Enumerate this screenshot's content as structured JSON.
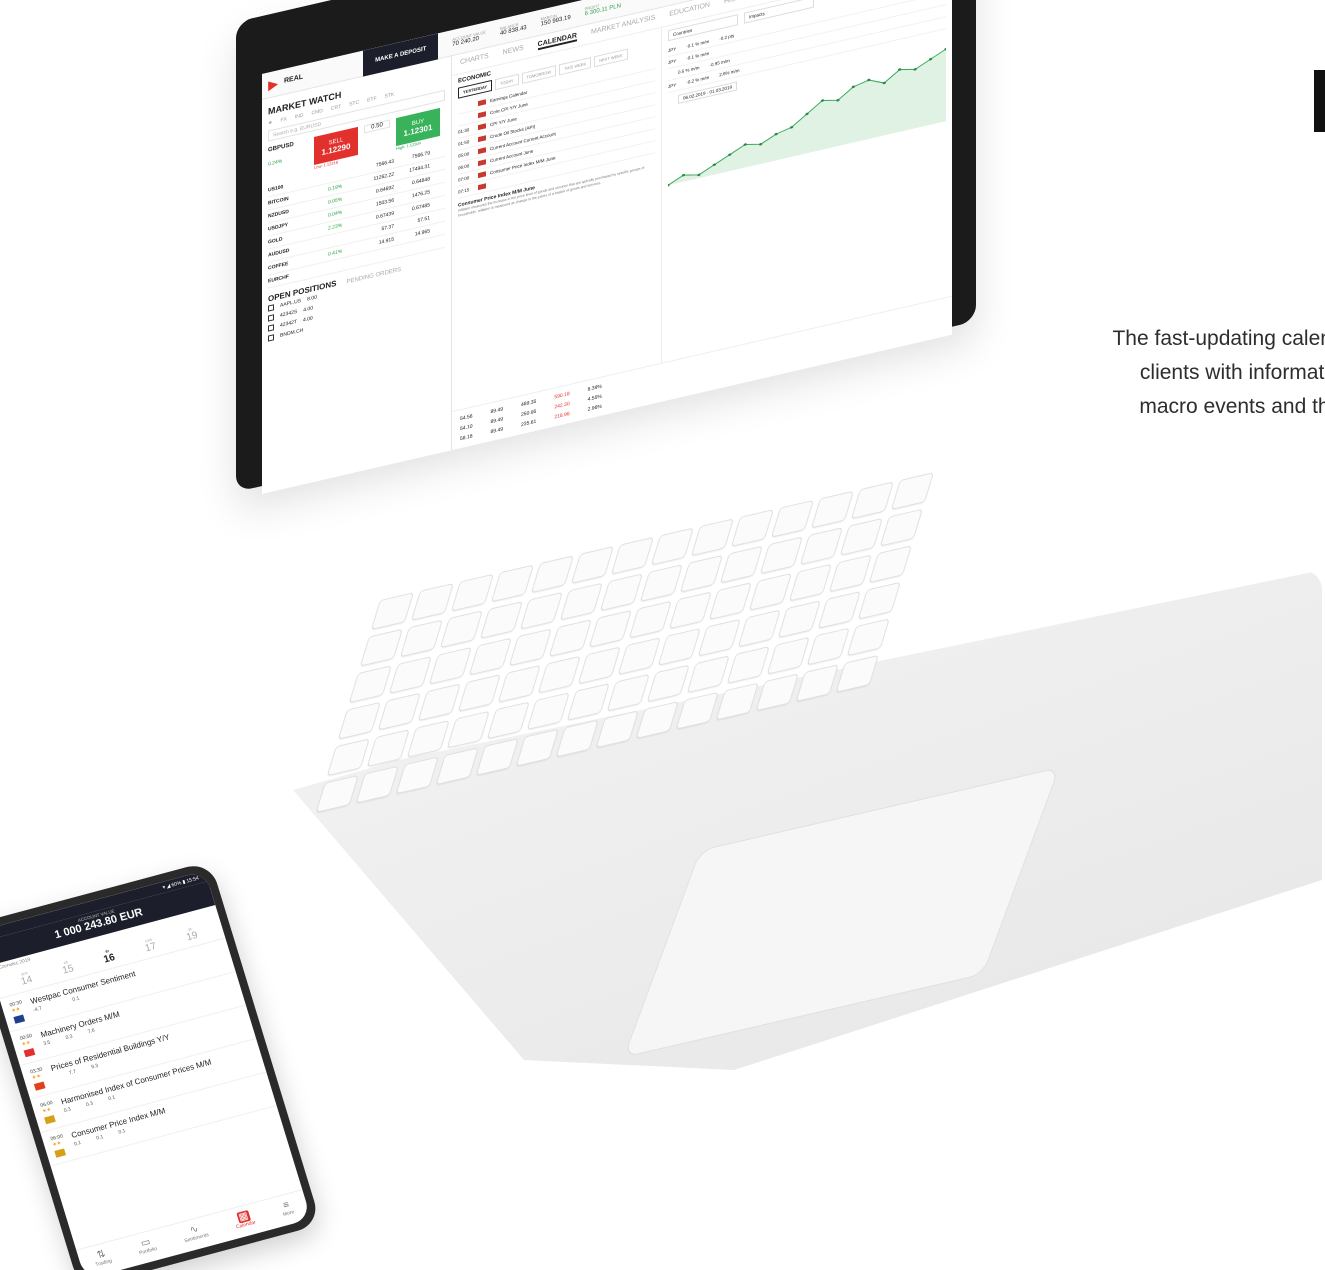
{
  "side": {
    "copy_lines": [
      "The fast-updating calendar provides",
      "clients with information on key",
      "macro events and their impact"
    ]
  },
  "laptop": {
    "account": "REAL",
    "deposit_button": "MAKE A DEPOSIT",
    "metrics": [
      {
        "label": "ACCOUNT VALUE",
        "value": "70 240.20",
        "green": false
      },
      {
        "label": "BALANCE",
        "value": "40 838.43",
        "green": false
      },
      {
        "label": "MARGIN",
        "value": "150 993.19",
        "green": false
      },
      {
        "label": "PROFIT",
        "value": "6 300.11 PLN",
        "green": true
      }
    ],
    "top_icons": [
      "layout-icon",
      "pulse-icon",
      "clock-icon",
      "bell-icon",
      "settings-icon",
      "user-icon",
      "power-icon"
    ],
    "market_watch": {
      "title": "MARKET WATCH",
      "tabs": [
        "★",
        "FX",
        "IND",
        "CMD",
        "CRT",
        "STC",
        "ETF",
        "STK"
      ],
      "search_placeholder": "Search e.g. EURUSD",
      "trade": {
        "symbol": "GBPUSD",
        "sell_label": "SELL",
        "sell_price": "1.12290",
        "low_label": "Low: 1.12218",
        "buy_label": "BUY",
        "buy_price": "1.12301",
        "high_label": "High: 1.12304",
        "quantity": "0.50",
        "change": "0.24%"
      },
      "instruments": [
        {
          "name": "US100",
          "change": "",
          "bid": "7566.43",
          "ask": "7566.79"
        },
        {
          "name": "BITCOIN",
          "change": "0.19%",
          "bid": "11262.22",
          "ask": "17494.31"
        },
        {
          "name": "NZDUSD",
          "change": "0.05%",
          "bid": "0.64692",
          "ask": "0.64848"
        },
        {
          "name": "USDJPY",
          "change": "0.04%",
          "bid": "1503.56",
          "ask": "1476.25"
        },
        {
          "name": "GOLD",
          "change": "2.23%",
          "bid": "0.67439",
          "ask": "0.67485"
        },
        {
          "name": "AUDUSD",
          "change": "",
          "bid": "57.37",
          "ask": "57.51"
        },
        {
          "name": "COFFEE",
          "change": "0.41%",
          "bid": "14.915",
          "ask": "14.965"
        },
        {
          "name": "EURCHF",
          "change": "",
          "bid": "",
          "ask": ""
        }
      ]
    },
    "positions": {
      "title": "OPEN POSITIONS",
      "pending_title": "PENDING ORDERS",
      "rows": [
        {
          "symbol": "AAPL.US",
          "volume": "8.00"
        },
        {
          "symbol": "42342S",
          "volume": "4.00"
        },
        {
          "symbol": "42342T",
          "volume": "4.00"
        },
        {
          "symbol": "BNDM.CH",
          "volume": ""
        }
      ]
    },
    "nav_tabs": [
      "CHARTS",
      "NEWS",
      "CALENDAR",
      "MARKET ANALYSIS",
      "EDUCATION",
      "HISTORY"
    ],
    "active_tab": "CALENDAR",
    "calendar": {
      "section": "ECONOMIC",
      "day_tabs": [
        "YESTERDAY",
        "TODAY",
        "TOMORROW",
        "THIS WEEK",
        "NEXT WEEK"
      ],
      "events": [
        {
          "time": "",
          "name": "Earnings Calendar"
        },
        {
          "time": "",
          "name": "Core CPI Y/Y June"
        },
        {
          "time": "01:30",
          "name": "CPI Y/Y June"
        },
        {
          "time": "01:50",
          "name": "Crude Oil Stocks (API)"
        },
        {
          "time": "05:00",
          "name": "Current Account Current Account"
        },
        {
          "time": "06:00",
          "name": "Current Account June"
        },
        {
          "time": "07:00",
          "name": "Consumer Price Index M/M June"
        },
        {
          "time": "07:15",
          "name": ""
        }
      ],
      "desc_title": "Consumer Price Index M/M June",
      "desc_text": "Inflation measures the increase in the price level of goods and services that are typically purchased by specific groups of households. Inflation is measured as change in the prices of a basket of goods and services.",
      "filters": [
        "Countries",
        "Impacts"
      ],
      "values": [
        {
          "currency": "JPY",
          "forecast": "-0.1 % m/m",
          "prev": "-0.2 pts"
        },
        {
          "currency": "JPY",
          "forecast": "-0.1 % m/m",
          "prev": ""
        },
        {
          "currency": "",
          "forecast": "0.5 % m/m",
          "prev": "-0.95 m/m"
        },
        {
          "currency": "JPY",
          "forecast": "-0.2 % m/m",
          "prev": "2.6% m/m"
        }
      ],
      "date_range": "06.02.2019 - 01.03.2019",
      "chart_points": [
        3,
        5,
        4,
        6,
        8,
        10,
        9,
        11,
        12,
        15,
        18,
        17,
        20,
        21,
        19,
        22,
        21,
        23,
        25
      ]
    },
    "bottom_table": [
      {
        "open_price": "54.56",
        "market_price": "89.49",
        "gross_profit": "489.35",
        "net_profit": "590.18",
        "net_pct": "6.39%"
      },
      {
        "open_price": "54.10",
        "market_price": "89.49",
        "gross_profit": "250.95",
        "net_profit": "242.30",
        "net_pct": "4.55%"
      },
      {
        "open_price": "58.18",
        "market_price": "89.49",
        "gross_profit": "235.61",
        "net_profit": "218.96",
        "net_pct": "2.96%"
      }
    ]
  },
  "phone": {
    "status": "▾ ◢ 60% ▮ 15:54",
    "header_label": "ACCOUNT VALUE",
    "header_value": "1 000 243.80 EUR",
    "month": "Czerwiec 2019",
    "days": [
      {
        "name": "pon",
        "num": "14"
      },
      {
        "name": "wt",
        "num": "15"
      },
      {
        "name": "śr",
        "num": "16"
      },
      {
        "name": "czw",
        "num": "17"
      },
      {
        "name": "pt",
        "num": "19"
      }
    ],
    "active_day": "16",
    "events": [
      {
        "time": "00:30",
        "title": "Westpac Consumer Sentiment",
        "stars": "★★",
        "flag": "#1f3f8f",
        "previous": "-4.7",
        "forecast": "",
        "actual": "0.1"
      },
      {
        "time": "00:50",
        "title": "Machinery Orders M/M",
        "stars": "★★",
        "flag": "#e03030",
        "previous": "3.5",
        "forecast": "0.3",
        "actual": "7.6"
      },
      {
        "time": "03:30",
        "title": "Prices of Residential Buildings Y/Y",
        "stars": "★★",
        "flag": "#e2401c",
        "previous": "",
        "forecast": "7.7",
        "actual": "9.3"
      },
      {
        "time": "06:00",
        "title": "Harmonised Index of Consumer Prices M/M",
        "stars": "★★",
        "flag": "#d6a017",
        "previous": "0.3",
        "forecast": "0.3",
        "actual": "0.1"
      },
      {
        "time": "06:00",
        "title": "Consumer Price Index M/M",
        "stars": "★★",
        "flag": "#d6a017",
        "previous": "0.1",
        "forecast": "0.1",
        "actual": "0.1"
      }
    ],
    "nav": [
      {
        "label": "Trading",
        "icon": "⇅"
      },
      {
        "label": "Portfolio",
        "icon": "▭"
      },
      {
        "label": "Sentiments",
        "icon": "∿"
      },
      {
        "label": "Calendar",
        "icon": "▦"
      },
      {
        "label": "More",
        "icon": "≡"
      }
    ],
    "active_nav": "Calendar"
  }
}
